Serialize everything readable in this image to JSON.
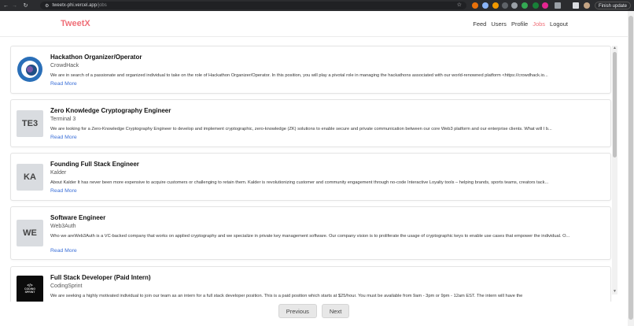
{
  "browser": {
    "url_host": "tweetx-phi.vercel.app",
    "url_path": "/jobs",
    "update_label": "Finish update"
  },
  "app": {
    "brand": "TweetX",
    "nav": [
      {
        "label": "Feed"
      },
      {
        "label": "Users"
      },
      {
        "label": "Profile"
      },
      {
        "label": "Jobs"
      },
      {
        "label": "Logout"
      }
    ],
    "accent": "#ef6f78"
  },
  "jobs": [
    {
      "title": "Hackathon Organizer/Operator",
      "company": "CrowdHack",
      "logo": "crowdhack-logo",
      "description": "We are in search of a passionate and organized individual to take on the role of Hackathon Organizer/Operator. In this position, you will play a pivotal role in managing the hackathons associated with our world-renowned platform <https://crowdhack.io...",
      "read_more": "Read More"
    },
    {
      "title": "Zero Knowledge Cryptography Engineer",
      "company": "Terminal 3",
      "logo_text": "TE3",
      "description": "We are looking for a Zero-Knowledge Cryptography Engineer to develop and implement cryptographic, zero-knowledge (ZK) solutions to enable secure and private communication between our core Web3 platform and our enterprise clients. What will I b...",
      "read_more": "Read More"
    },
    {
      "title": "Founding Full Stack Engineer",
      "company": "Kalder",
      "logo_text": "KA",
      "description": "About Kalder It has never been more expensive to acquire customers or challenging to retain them. Kalder is revolutionizing customer and community engagement through no-code Interactive Loyalty tools – helping brands, sports teams, creators tack...",
      "read_more": "Read More"
    },
    {
      "title": "Software Engineer",
      "company": "Web3Auth",
      "logo_text": "WE",
      "description": "Who we areWeb3Auth is a VC-backed company that works on applied cryptography and we specialize in private key management software. Our company vision is to proliferate the usage of cryptographic keys to enable use cases that empower the individual. O...",
      "read_more": "Read More"
    },
    {
      "title": "Full Stack Developer (Paid Intern)",
      "company": "CodingSprint",
      "logo_lines": [
        "CODING",
        "SPRINT"
      ],
      "description": "We are seeking a highly motivated individual to join our team as an intern for a full stack developer position. This is a paid position which starts at $25/hour. You must be available from 9am - 3pm or 9pm - 12am EST. The intern will have the"
    }
  ],
  "pagination": {
    "previous": "Previous",
    "next": "Next"
  }
}
